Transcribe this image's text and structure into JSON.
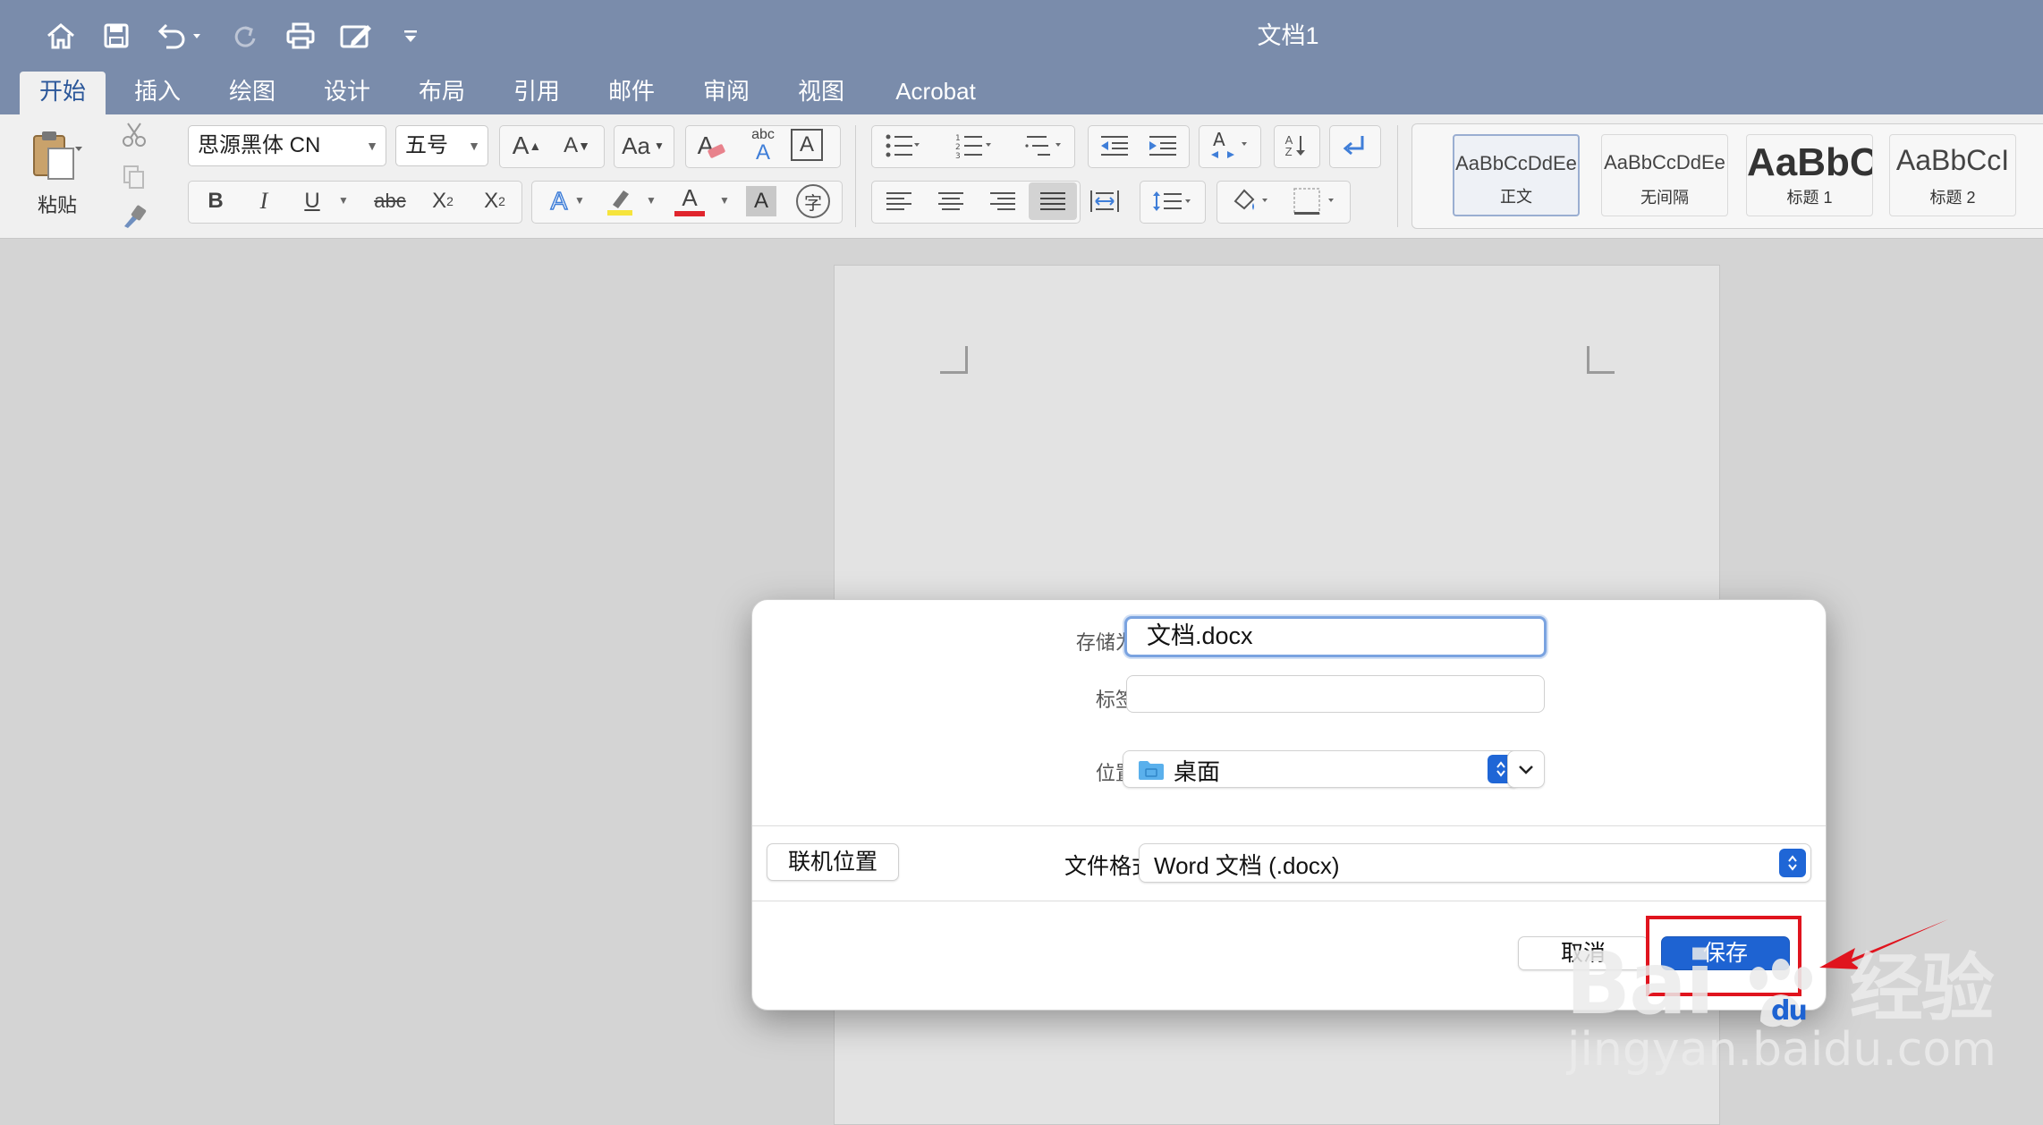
{
  "app": {
    "document_title": "文档1",
    "quick_access": [
      "home-icon",
      "save-icon",
      "undo-icon",
      "redo-icon",
      "print-icon",
      "edit-doc-icon",
      "customize-icon"
    ]
  },
  "tabs": [
    {
      "label": "开始",
      "active": true
    },
    {
      "label": "插入"
    },
    {
      "label": "绘图"
    },
    {
      "label": "设计"
    },
    {
      "label": "布局"
    },
    {
      "label": "引用"
    },
    {
      "label": "邮件"
    },
    {
      "label": "审阅"
    },
    {
      "label": "视图"
    },
    {
      "label": "Acrobat"
    }
  ],
  "ribbon": {
    "paste_label": "粘贴",
    "font_name": "思源黑体 CN",
    "font_size": "五号",
    "format_buttons": {
      "bold": "B",
      "italic": "I",
      "underline": "U",
      "strike": "abc",
      "subscript": "X",
      "subscript_mark": "2",
      "superscript": "X",
      "superscript_mark": "2",
      "grow": "A",
      "shrink": "A",
      "change_case": "Aa",
      "clear_format": "A",
      "phonetic_top": "abc",
      "phonetic_bottom": "A",
      "char_border": "A",
      "text_effect": "A",
      "font_color": "A",
      "char_shading": "A",
      "enclose": "字",
      "sort_top": "A",
      "sort_bottom": "Z"
    },
    "styles": [
      {
        "sample": "AaBbCcDdEe",
        "name": "正文",
        "selected": true
      },
      {
        "sample": "AaBbCcDdEe",
        "name": "无间隔"
      },
      {
        "sample": "AaBbC",
        "name": "标题 1"
      },
      {
        "sample": "AaBbCcI",
        "name": "标题 2"
      }
    ]
  },
  "dialog": {
    "save_as_label": "存储为:",
    "save_as_value": "文档.docx",
    "tags_label": "标签:",
    "tags_value": "",
    "location_label": "位置:",
    "location_value": "桌面",
    "online_button": "联机位置",
    "format_label": "文件格式:",
    "format_value": "Word 文档 (.docx)",
    "cancel_button": "取消",
    "save_button": "保存"
  },
  "watermark": {
    "brand_a": "Bai",
    "brand_b": "经验",
    "url": "jingyan.baidu.com"
  },
  "colors": {
    "titlebar": "#7a8cab",
    "accent": "#1e63d2",
    "highlight_box": "#e0141e"
  }
}
